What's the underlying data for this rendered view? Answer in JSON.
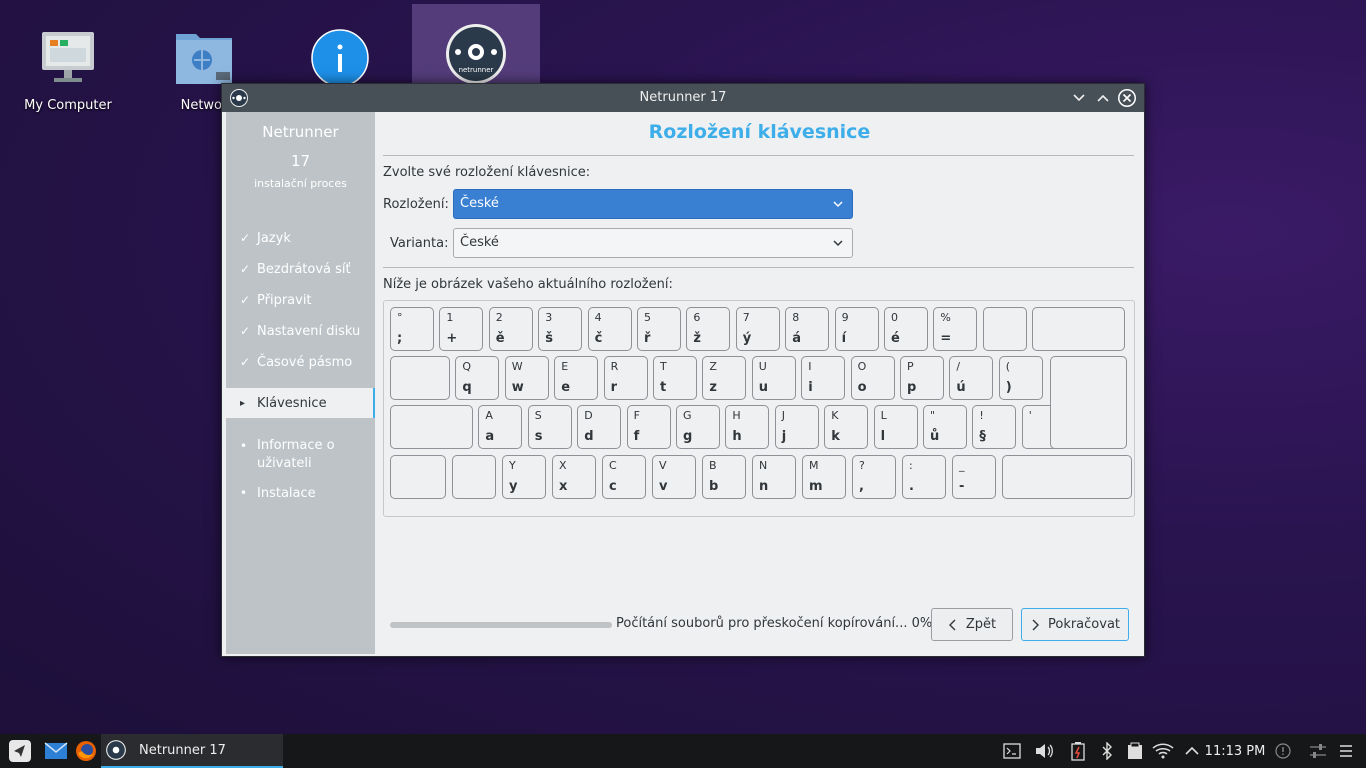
{
  "desktop": {
    "icons": [
      {
        "label": "My Computer",
        "icon": "monitor-icon"
      },
      {
        "label": "Networ",
        "icon": "network-folder-icon"
      },
      {
        "label": "",
        "icon": "info-icon"
      },
      {
        "label": "",
        "icon": "netrunner-disc-icon"
      }
    ]
  },
  "window": {
    "title": "Netrunner 17",
    "buttons": {
      "minimize": "chevron-down-icon",
      "maximize": "chevron-up-icon",
      "close": "close-icon"
    }
  },
  "sidebar": {
    "app_name": "Netrunner",
    "version": "17",
    "subtitle": "instalační proces",
    "steps": [
      {
        "label": "Jazyk",
        "mark": "✓"
      },
      {
        "label": "Bezdrátová síť",
        "mark": "✓"
      },
      {
        "label": "Připravit",
        "mark": "✓"
      },
      {
        "label": "Nastavení disku",
        "mark": "✓"
      },
      {
        "label": "Časové pásmo",
        "mark": "✓"
      },
      {
        "label": "Klávesnice",
        "mark": "▸"
      },
      {
        "label": "Informace o uživateli",
        "mark": "•"
      },
      {
        "label": "Instalace",
        "mark": "•"
      }
    ]
  },
  "page": {
    "heading": "Rozložení klávesnice",
    "choose_label": "Zvolte své rozložení klávesnice:",
    "layout_label": "Rozložení:",
    "layout_value": "České",
    "variant_label": "Varianta:",
    "variant_value": "České",
    "preview_label": "Níže je obrázek vašeho aktuálního rozložení:"
  },
  "keyboard": {
    "rows": [
      [
        [
          "°",
          ";"
        ],
        [
          "1",
          "+"
        ],
        [
          "2",
          "ě"
        ],
        [
          "3",
          "š"
        ],
        [
          "4",
          "č"
        ],
        [
          "5",
          "ř"
        ],
        [
          "6",
          "ž"
        ],
        [
          "7",
          "ý"
        ],
        [
          "8",
          "á"
        ],
        [
          "9",
          "í"
        ],
        [
          "0",
          "é"
        ],
        [
          "%",
          "="
        ],
        [
          "",
          ""
        ],
        [
          "",
          ""
        ]
      ],
      [
        [
          "",
          ""
        ],
        [
          "Q",
          "q"
        ],
        [
          "W",
          "w"
        ],
        [
          "E",
          "e"
        ],
        [
          "R",
          "r"
        ],
        [
          "T",
          "t"
        ],
        [
          "Z",
          "z"
        ],
        [
          "U",
          "u"
        ],
        [
          "I",
          "i"
        ],
        [
          "O",
          "o"
        ],
        [
          "P",
          "p"
        ],
        [
          "/",
          "ú"
        ],
        [
          "(",
          ")"
        ]
      ],
      [
        [
          "",
          ""
        ],
        [
          "A",
          "a"
        ],
        [
          "S",
          "s"
        ],
        [
          "D",
          "d"
        ],
        [
          "F",
          "f"
        ],
        [
          "G",
          "g"
        ],
        [
          "H",
          "h"
        ],
        [
          "J",
          "j"
        ],
        [
          "K",
          "k"
        ],
        [
          "L",
          "l"
        ],
        [
          "\"",
          "ů"
        ],
        [
          "!",
          "§"
        ],
        [
          "'",
          ""
        ]
      ],
      [
        [
          "",
          ""
        ],
        [
          "",
          ""
        ],
        [
          "Y",
          "y"
        ],
        [
          "X",
          "x"
        ],
        [
          "C",
          "c"
        ],
        [
          "V",
          "v"
        ],
        [
          "B",
          "b"
        ],
        [
          "N",
          "n"
        ],
        [
          "M",
          "m"
        ],
        [
          "?",
          ","
        ],
        [
          ":",
          "."
        ],
        [
          "_",
          "-"
        ],
        [
          "",
          ""
        ]
      ]
    ]
  },
  "footer": {
    "status": "Počítání souborů pro přeskočení kopírování... 0%",
    "progress": 0,
    "back_label": "Zpět",
    "next_label": "Pokračovat"
  },
  "taskbar": {
    "window_label": "Netrunner 17",
    "clock": "11:13 PM",
    "launchers": [
      "netrunner-menu-icon",
      "mail-icon",
      "firefox-icon"
    ],
    "tray": [
      "terminal-icon",
      "volume-icon",
      "battery-icon",
      "bluetooth-icon",
      "clipboard-icon",
      "wifi-icon",
      "chevron-up-icon",
      "notification-icon",
      "settings-sliders-icon",
      "menu-icon"
    ]
  }
}
